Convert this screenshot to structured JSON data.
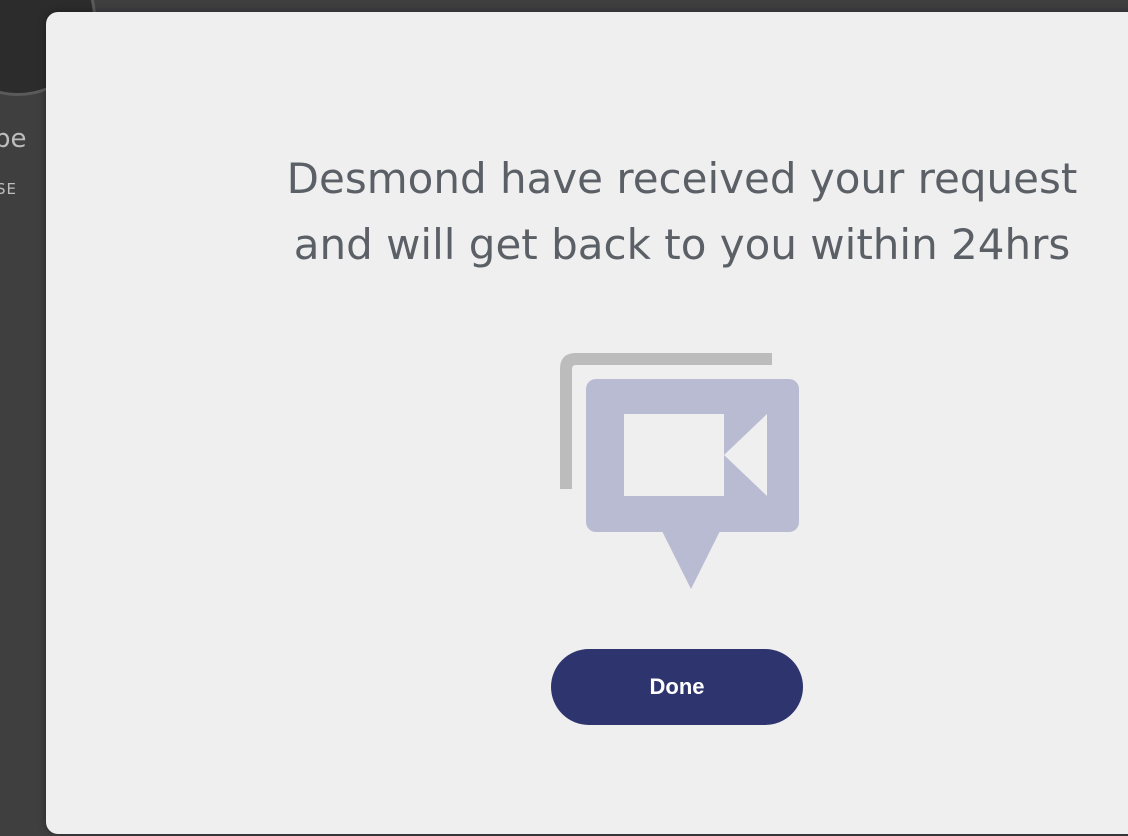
{
  "background": {
    "partial_name": "pe",
    "partial_label": "SE"
  },
  "modal": {
    "message_line_1": "Desmond have received your request",
    "message_line_2": "and will get back to you within 24hrs",
    "icon": "video-chat-icon",
    "done_label": "Done"
  },
  "colors": {
    "overlay": "#3f3f40",
    "modal_background": "#efefef",
    "text": "#5b5f66",
    "icon_primary": "#b9bbd2",
    "icon_shadow": "#bcbcbc",
    "button": "#2e356e",
    "button_text": "#ffffff"
  }
}
